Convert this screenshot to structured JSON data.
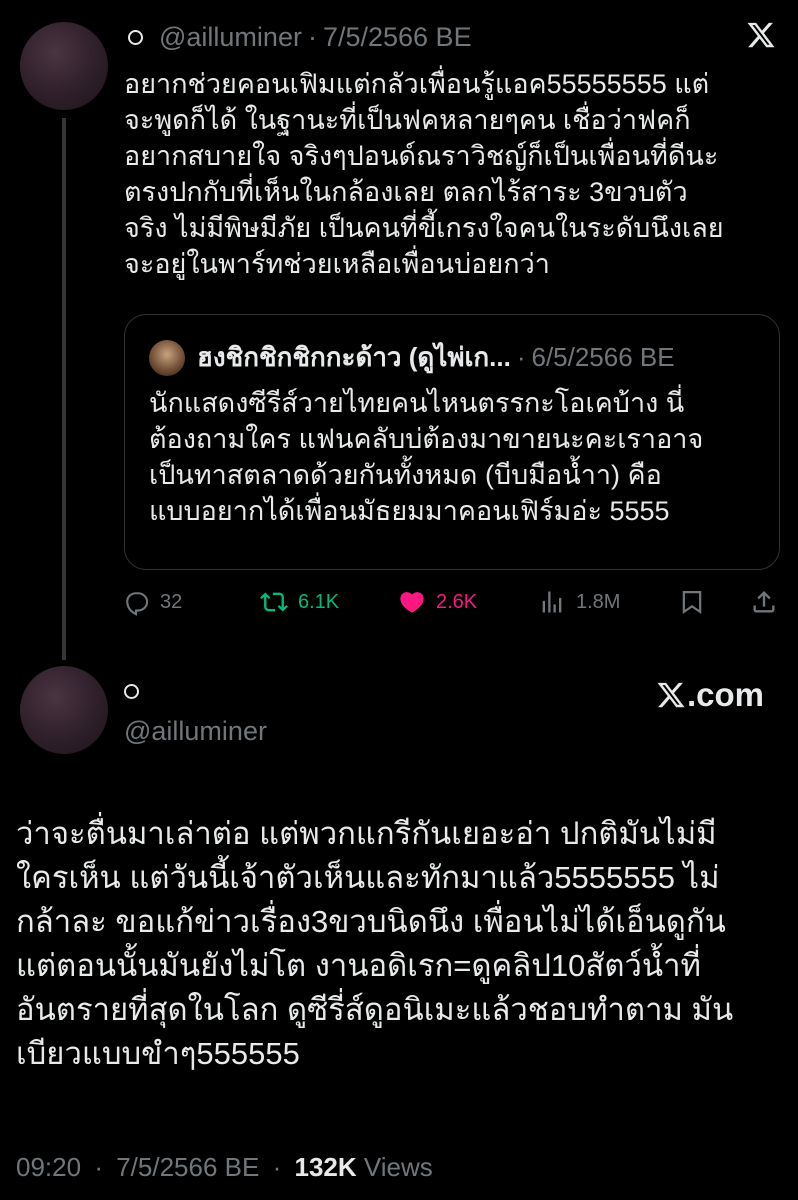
{
  "main_tweet": {
    "handle": "@ailluminer",
    "date": "7/5/2566 BE",
    "lines": [
      "อยากช่วยคอนเฟิมแต่กลัวเพื่อนรู้แอค55555555 แต่",
      "จะพูดก็ได้ ในฐานะที่เป็นฟคหลายๆคน เชื่อว่าฟคก็",
      "อยากสบายใจ จริงๆปอนด์ณราวิชญ์ก็เป็นเพื่อนที่ดีนะ",
      "ตรงปกกับที่เห็นในกล้องเลย ตลกไร้สาระ 3ขวบตัว",
      "จริง ไม่มีพิษมีภัย เป็นคนที่ขี้เกรงใจคนในระดับนึงเลย",
      "จะอยู่ในพาร์ทช่วยเหลือเพื่อนบ่อยกว่า"
    ],
    "quoted": {
      "name": "ฮงชิกชิกชิกกะด้าว (ดูไพ่เก...",
      "date": "6/5/2566 BE",
      "lines": [
        "นักแสดงซีรีส์วายไทยคนไหนตรรกะโอเคบ้าง นี่",
        "ต้องถามใคร แฟนคลับบ่ต้องมาขายนะคะเราอาจ",
        "เป็นทาสตลาดด้วยกันทั้งหมด (บีบมือน้ำา) คือ",
        "แบบอยากได้เพื่อนมัธยมมาคอนเฟิร์มอ่ะ 5555"
      ]
    },
    "actions": {
      "replies": "32",
      "reposts": "6.1K",
      "likes": "2.6K",
      "views": "1.8M"
    }
  },
  "reply_tweet": {
    "handle": "@ailluminer",
    "brand": ".com",
    "lines": [
      "ว่าจะตื่นมาเล่าต่อ แต่พวกแกรีกันเยอะอ่า ปกติมันไม่มี",
      "ใครเห็น  แต่วันนี้เจ้าตัวเห็นและทักมาแล้ว5555555 ไม่",
      "กล้าละ ขอแก้ข่าวเรื่อง3ขวบนิดนึง เพื่อนไม่ได้เอ็นดูกัน",
      "แต่ตอนนั้นมันยังไม่โต งานอดิเรก=ดูคลิป10สัตว์น้ำที่",
      "อันตรายที่สุดในโลก ดูซีรี่ส์ดูอนิเมะแล้วชอบทำตาม มัน",
      "เบียวแบบขำๆ555555"
    ],
    "time": "09:20",
    "date": "7/5/2566 BE",
    "views_count": "132K",
    "views_label": "Views"
  },
  "colors": {
    "background": "#000000",
    "text": "#e7e9ea",
    "muted": "#71767b",
    "repost": "#00ba7c",
    "like": "#f91880"
  },
  "icons": [
    "x-logo-icon",
    "reply-icon",
    "repost-icon",
    "heart-icon",
    "views-icon",
    "bookmark-icon",
    "share-icon"
  ]
}
